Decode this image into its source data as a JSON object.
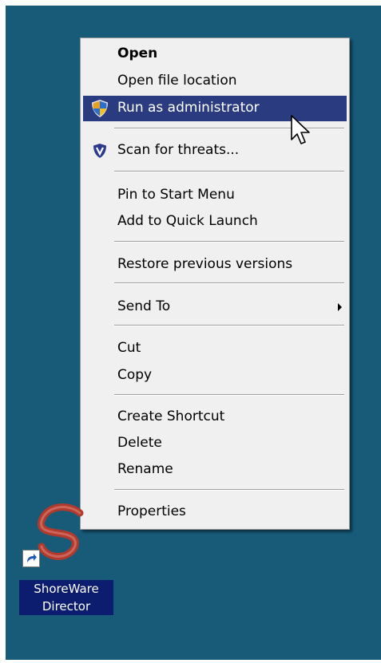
{
  "menu": {
    "items": [
      {
        "label": "Open",
        "bold": true
      },
      {
        "label": "Open file location"
      },
      {
        "label": "Run as administrator",
        "icon": "uac-shield-icon",
        "highlighted": true
      },
      {
        "label": "Scan for threats...",
        "icon": "antivirus-shield-icon"
      },
      {
        "label": "Pin to Start Menu"
      },
      {
        "label": "Add to Quick Launch"
      },
      {
        "label": "Restore previous versions"
      },
      {
        "label": "Send To",
        "submenu": true
      },
      {
        "label": "Cut"
      },
      {
        "label": "Copy"
      },
      {
        "label": "Create Shortcut"
      },
      {
        "label": "Delete"
      },
      {
        "label": "Rename"
      },
      {
        "label": "Properties"
      }
    ]
  },
  "desktop_icon": {
    "label_line1": "ShoreWare",
    "label_line2": "Director",
    "icon": "shoreware-logo-icon",
    "overlay_icon": "shortcut-arrow-icon"
  },
  "colors": {
    "desktop": "#175b79",
    "menu_bg": "#f0f0f0",
    "highlight": "#2a3b80",
    "icon_label_bg": "#0c1c6e"
  }
}
